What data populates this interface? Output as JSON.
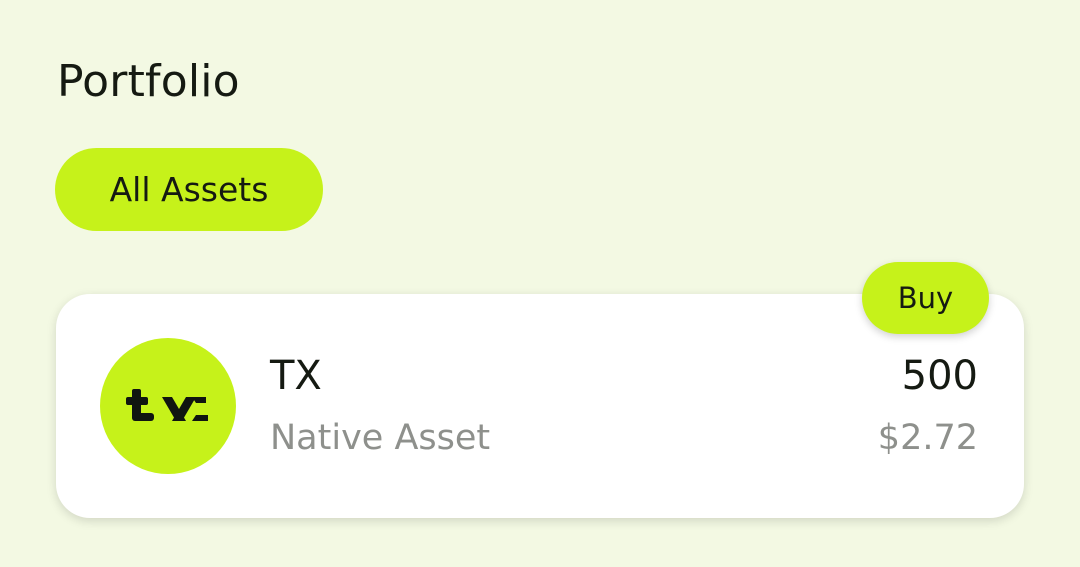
{
  "header": {
    "title": "Portfolio"
  },
  "filters": {
    "active_label": "All Assets"
  },
  "assets": [
    {
      "symbol": "TX",
      "subtitle": "Native Asset",
      "amount": "500",
      "value": "$2.72",
      "logo_icon": "tx-logo-icon",
      "buy_label": "Buy"
    }
  ],
  "colors": {
    "background": "#f3f9e3",
    "accent": "#c6f21a",
    "card": "#ffffff",
    "text_primary": "#151a12",
    "text_secondary": "#8e908c"
  }
}
